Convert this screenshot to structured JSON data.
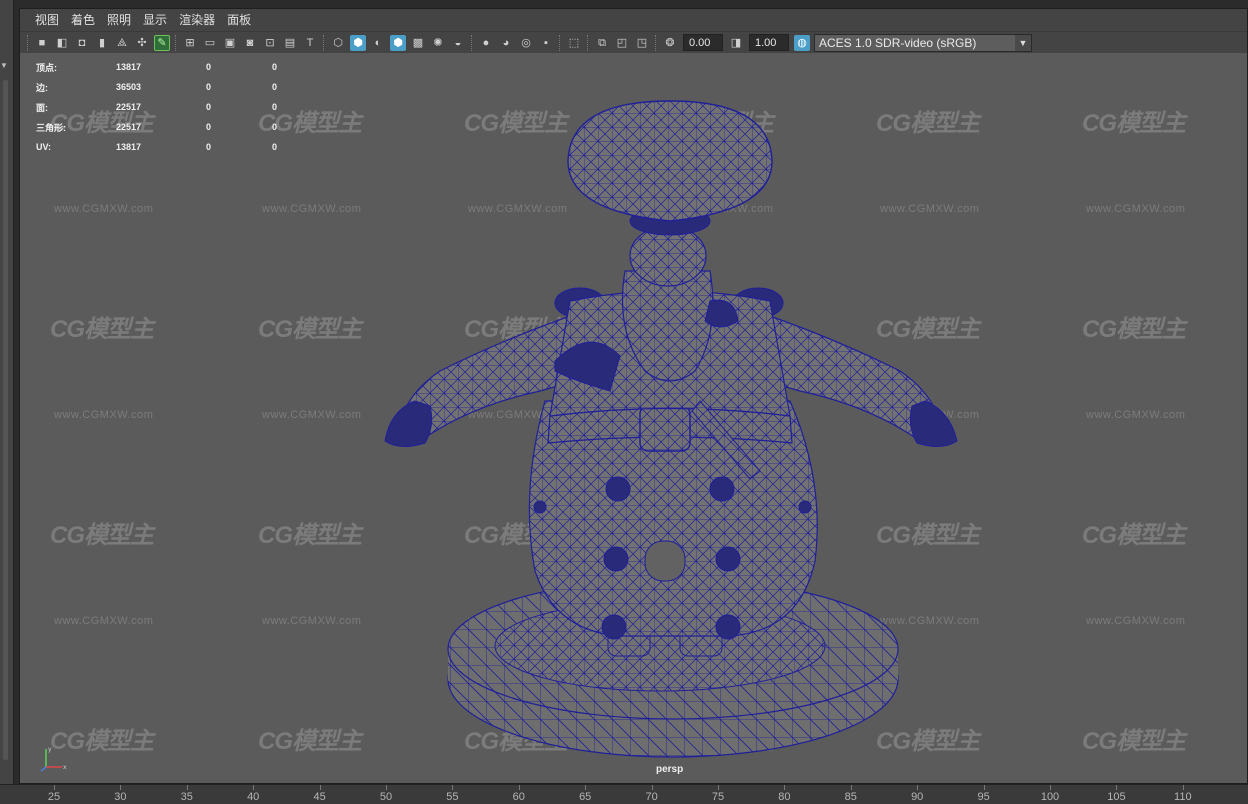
{
  "menu": [
    "视图",
    "着色",
    "照明",
    "显示",
    "渲染器",
    "面板"
  ],
  "toolbar": {
    "exposure_value": "0.00",
    "gamma_value": "1.00",
    "colorspace": "ACES 1.0 SDR-video (sRGB)"
  },
  "hud": {
    "rows": [
      {
        "label": "顶点:",
        "v1": "13817",
        "v2": "0",
        "v3": "0"
      },
      {
        "label": "边:",
        "v1": "36503",
        "v2": "0",
        "v3": "0"
      },
      {
        "label": "面:",
        "v1": "22517",
        "v2": "0",
        "v3": "0"
      },
      {
        "label": "三角形:",
        "v1": "22517",
        "v2": "0",
        "v3": "0"
      },
      {
        "label": "UV:",
        "v1": "13817",
        "v2": "0",
        "v3": "0"
      }
    ]
  },
  "viewport": {
    "camera": "persp",
    "wireframe_color": "#1f1f9a",
    "watermark_logo": "CG模型主",
    "watermark_url": "www.CGMXW.com"
  },
  "timeline": {
    "ticks": [
      "25",
      "30",
      "35",
      "40",
      "45",
      "50",
      "55",
      "60",
      "65",
      "70",
      "75",
      "80",
      "85",
      "90",
      "95",
      "100",
      "105",
      "110"
    ]
  }
}
